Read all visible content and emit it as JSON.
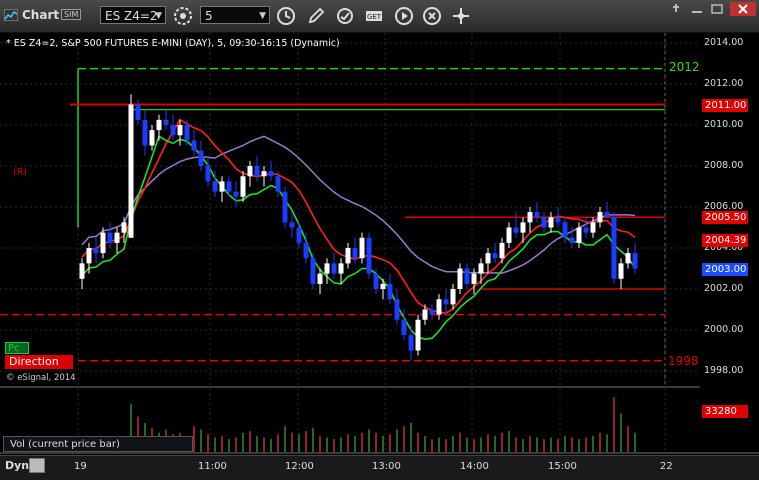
{
  "toolbar": {
    "app_title": "Chart",
    "sim_badge": "SIM",
    "symbol": "ES Z4=2",
    "interval": "5",
    "icons": [
      "link-icon",
      "clock-icon",
      "pencil-icon",
      "refresh-icon",
      "study-icon",
      "play-icon",
      "fullscreen-icon"
    ]
  },
  "chart": {
    "title": "* ES Z4=2, S&P 500 FUTURES E-MINI (DAY), 5, 09:30-16:15 (Dynamic)",
    "copyright": "© eSignal, 2014",
    "r_label": "(R)",
    "pc_tag": "Pc",
    "direction_tag": "Direction",
    "level_labels": {
      "upper": "2012",
      "lower": "1998"
    },
    "price_tags": [
      {
        "value": "2011.00",
        "color": "#e00000"
      },
      {
        "value": "2005.50",
        "color": "#e00000"
      },
      {
        "value": "2004.39",
        "color": "#e00000"
      },
      {
        "value": "2003.00",
        "color": "#1a4dff"
      }
    ],
    "y_ticks": [
      "2014.00",
      "2012.00",
      "2010.00",
      "2008.00",
      "2006.00",
      "2004.00",
      "2002.00",
      "2000.00",
      "1998.00"
    ],
    "x_ticks": [
      "19",
      "11:00",
      "12:00",
      "13:00",
      "14:00",
      "15:00",
      "22"
    ],
    "vol_label": "Vol (current price bar)",
    "vol_tag": "33280",
    "dyn_label": "Dyn",
    "colors": {
      "up_bar": "#ffffff",
      "down_bar": "#1a3dff",
      "ma_red": "#ff2020",
      "ma_green": "#22dd22",
      "ma_purple": "#9a7acc",
      "level_red": "#e00000",
      "level_green": "#22cc22"
    }
  },
  "chart_data": {
    "type": "candlestick",
    "title": "* ES Z4=2, S&P 500 FUTURES E-MINI (DAY), 5, 09:30-16:15 (Dynamic)",
    "ylim": [
      1997.5,
      2014.5
    ],
    "grid": true,
    "levels": [
      2012.75,
      2011.0,
      2010.75,
      2005.5,
      2002.0,
      2000.75,
      1998.5
    ],
    "ohlc": [
      [
        2002.5,
        2003.5,
        2002.0,
        2003.25
      ],
      [
        2003.25,
        2004.25,
        2002.75,
        2004.0
      ],
      [
        2004.0,
        2004.5,
        2003.25,
        2003.75
      ],
      [
        2003.75,
        2005.0,
        2003.5,
        2004.75
      ],
      [
        2004.75,
        2005.25,
        2004.0,
        2004.25
      ],
      [
        2004.25,
        2005.0,
        2003.75,
        2004.75
      ],
      [
        2004.75,
        2005.5,
        2004.25,
        2005.25
      ],
      [
        2004.5,
        2011.5,
        2004.5,
        2011.0
      ],
      [
        2011.0,
        2011.25,
        2010.0,
        2010.25
      ],
      [
        2010.25,
        2010.75,
        2008.5,
        2009.0
      ],
      [
        2009.0,
        2010.0,
        2008.75,
        2009.75
      ],
      [
        2009.75,
        2010.5,
        2009.25,
        2010.25
      ],
      [
        2010.25,
        2010.75,
        2009.75,
        2010.0
      ],
      [
        2010.0,
        2010.5,
        2009.25,
        2009.5
      ],
      [
        2009.5,
        2010.25,
        2009.0,
        2010.0
      ],
      [
        2010.0,
        2010.25,
        2009.0,
        2009.25
      ],
      [
        2009.25,
        2009.75,
        2008.5,
        2008.75
      ],
      [
        2008.75,
        2009.25,
        2007.75,
        2008.0
      ],
      [
        2008.0,
        2008.5,
        2007.0,
        2007.25
      ],
      [
        2007.25,
        2007.75,
        2006.5,
        2006.75
      ],
      [
        2006.75,
        2007.5,
        2006.25,
        2007.25
      ],
      [
        2007.25,
        2007.5,
        2006.5,
        2006.75
      ],
      [
        2006.75,
        2007.25,
        2006.0,
        2006.5
      ],
      [
        2006.5,
        2007.75,
        2006.25,
        2007.5
      ],
      [
        2007.5,
        2008.25,
        2007.0,
        2008.0
      ],
      [
        2008.0,
        2008.5,
        2007.25,
        2007.5
      ],
      [
        2007.5,
        2008.0,
        2007.0,
        2007.75
      ],
      [
        2007.75,
        2008.25,
        2007.25,
        2007.5
      ],
      [
        2007.5,
        2007.75,
        2006.5,
        2006.75
      ],
      [
        2006.75,
        2007.0,
        2005.0,
        2005.25
      ],
      [
        2005.25,
        2005.75,
        2004.5,
        2005.0
      ],
      [
        2005.0,
        2005.25,
        2004.0,
        2004.25
      ],
      [
        2004.25,
        2004.75,
        2003.25,
        2003.5
      ],
      [
        2003.5,
        2003.75,
        2002.0,
        2002.25
      ],
      [
        2002.25,
        2003.0,
        2001.75,
        2002.75
      ],
      [
        2002.75,
        2003.5,
        2002.25,
        2003.25
      ],
      [
        2003.25,
        2003.75,
        2002.5,
        2002.75
      ],
      [
        2002.75,
        2003.5,
        2002.25,
        2003.25
      ],
      [
        2003.25,
        2004.25,
        2003.0,
        2004.0
      ],
      [
        2004.0,
        2004.5,
        2003.25,
        2003.5
      ],
      [
        2003.5,
        2004.75,
        2003.25,
        2004.5
      ],
      [
        2004.5,
        2004.75,
        2002.5,
        2002.75
      ],
      [
        2002.75,
        2003.0,
        2001.75,
        2002.0
      ],
      [
        2002.0,
        2002.5,
        2001.5,
        2002.25
      ],
      [
        2002.25,
        2002.75,
        2001.25,
        2001.5
      ],
      [
        2001.5,
        2002.0,
        2000.25,
        2000.5
      ],
      [
        2000.5,
        2001.0,
        1999.5,
        1999.75
      ],
      [
        1999.75,
        2000.25,
        1998.5,
        1999.0
      ],
      [
        1999.0,
        2000.75,
        1998.75,
        2000.5
      ],
      [
        2000.5,
        2001.25,
        2000.25,
        2001.0
      ],
      [
        2001.0,
        2001.25,
        2000.5,
        2000.75
      ],
      [
        2000.75,
        2001.75,
        2000.5,
        2001.5
      ],
      [
        2001.5,
        2002.0,
        2000.75,
        2001.25
      ],
      [
        2001.25,
        2002.25,
        2001.0,
        2002.0
      ],
      [
        2002.0,
        2003.25,
        2001.75,
        2003.0
      ],
      [
        2003.0,
        2003.25,
        2002.0,
        2002.25
      ],
      [
        2002.25,
        2003.0,
        2001.75,
        2002.75
      ],
      [
        2002.75,
        2003.5,
        2002.25,
        2003.25
      ],
      [
        2003.25,
        2004.0,
        2002.75,
        2003.75
      ],
      [
        2003.75,
        2004.25,
        2003.25,
        2003.5
      ],
      [
        2003.5,
        2004.5,
        2003.25,
        2004.25
      ],
      [
        2004.25,
        2005.25,
        2004.0,
        2005.0
      ],
      [
        2005.0,
        2005.75,
        2004.5,
        2004.75
      ],
      [
        2004.75,
        2005.5,
        2004.25,
        2005.25
      ],
      [
        2005.25,
        2006.0,
        2004.75,
        2005.75
      ],
      [
        2005.75,
        2006.25,
        2005.25,
        2005.5
      ],
      [
        2005.5,
        2005.75,
        2004.75,
        2005.0
      ],
      [
        2005.0,
        2005.75,
        2004.75,
        2005.5
      ],
      [
        2005.5,
        2006.0,
        2005.0,
        2005.25
      ],
      [
        2005.25,
        2005.5,
        2004.25,
        2004.5
      ],
      [
        2004.5,
        2005.0,
        2004.0,
        2004.25
      ],
      [
        2004.25,
        2005.25,
        2004.0,
        2005.0
      ],
      [
        2005.0,
        2005.5,
        2004.5,
        2004.75
      ],
      [
        2004.75,
        2005.5,
        2004.5,
        2005.25
      ],
      [
        2005.25,
        2006.0,
        2005.0,
        2005.75
      ],
      [
        2005.75,
        2006.25,
        2005.5,
        2005.5
      ],
      [
        2005.5,
        2005.75,
        2002.25,
        2002.5
      ],
      [
        2002.5,
        2003.5,
        2002.0,
        2003.25
      ],
      [
        2003.25,
        2004.0,
        2003.0,
        2003.75
      ],
      [
        2003.75,
        2004.25,
        2002.75,
        2003.0
      ]
    ],
    "volume": [
      6,
      5,
      4,
      5,
      4,
      5,
      4,
      30,
      22,
      18,
      15,
      12,
      14,
      11,
      12,
      10,
      16,
      14,
      11,
      9,
      10,
      8,
      9,
      12,
      13,
      10,
      9,
      8,
      11,
      16,
      12,
      11,
      13,
      15,
      10,
      9,
      8,
      9,
      11,
      10,
      12,
      14,
      12,
      10,
      11,
      14,
      16,
      18,
      12,
      10,
      8,
      9,
      8,
      10,
      12,
      9,
      8,
      9,
      11,
      10,
      12,
      13,
      9,
      8,
      10,
      9,
      8,
      9,
      8,
      10,
      9,
      8,
      9,
      10,
      12,
      11,
      34,
      24,
      16,
      12
    ]
  }
}
